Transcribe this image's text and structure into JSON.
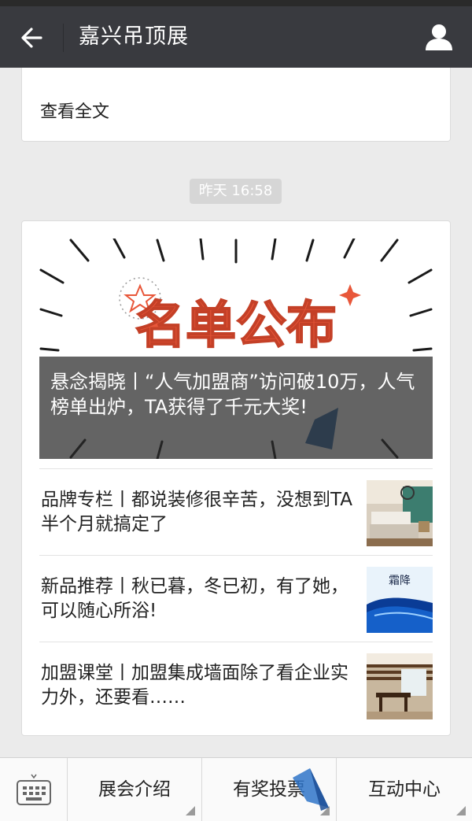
{
  "header": {
    "title": "嘉兴吊顶展"
  },
  "previous_message": {
    "read_more": "查看全文"
  },
  "timestamp": "昨天 16:58",
  "main_card": {
    "cover_image_text": "名单公布",
    "cover_headline": "悬念揭晓丨“人气加盟商”访问破10万，人气榜单出炉，TA获得了千元大奖!",
    "articles": [
      {
        "title": "品牌专栏丨都说装修很辛苦，没想到TA半个月就搞定了",
        "thumb": "bedroom-photo"
      },
      {
        "title": "新品推荐丨秋已暮，冬已初，有了她，可以随心所浴!",
        "thumb": "frost-poster",
        "thumb_text": "霜降"
      },
      {
        "title": "加盟课堂丨加盟集成墙面除了看企业实力外，还要看……",
        "thumb": "dining-room-photo"
      }
    ]
  },
  "bottom_menu": {
    "items": [
      {
        "label": "展会介绍"
      },
      {
        "label": "有奖投票"
      },
      {
        "label": "互动中心"
      }
    ]
  },
  "colors": {
    "header_bg": "#393a3f",
    "page_bg": "#ebebeb",
    "cover_text": "#e8573a"
  },
  "icons": [
    "back-arrow-icon",
    "user-profile-icon",
    "keyboard-icon"
  ]
}
